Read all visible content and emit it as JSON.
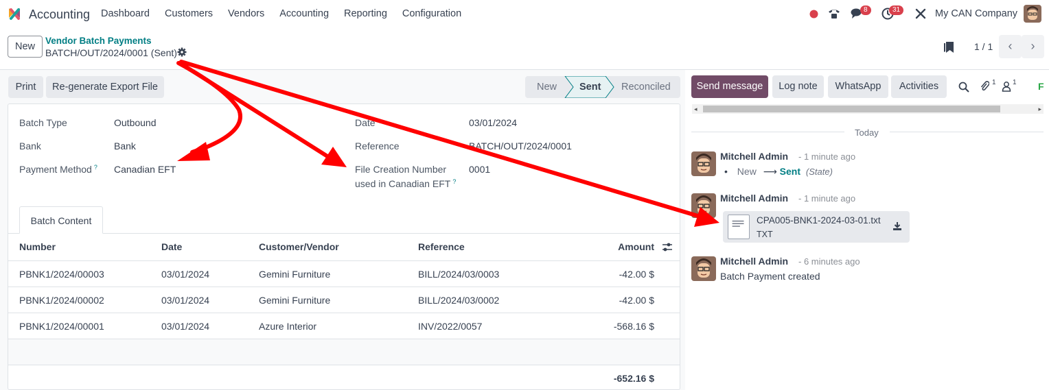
{
  "topnav": {
    "app_name": "Accounting",
    "menu": [
      "Dashboard",
      "Customers",
      "Vendors",
      "Accounting",
      "Reporting",
      "Configuration"
    ],
    "messages_badge": "8",
    "activities_badge": "31",
    "company": "My CAN Company"
  },
  "control": {
    "new_label": "New",
    "breadcrumb_parent": "Vendor Batch Payments",
    "breadcrumb_current": "BATCH/OUT/2024/0001 (Sent)",
    "pager": "1 / 1"
  },
  "actions": {
    "print": "Print",
    "regenerate": "Re-generate Export File"
  },
  "status": {
    "stages": [
      "New",
      "Sent",
      "Reconciled"
    ],
    "current": "Sent"
  },
  "form": {
    "batch_type_label": "Batch Type",
    "batch_type": "Outbound",
    "bank_label": "Bank",
    "bank": "Bank",
    "payment_method_label": "Payment Method",
    "payment_method": "Canadian EFT",
    "date_label": "Date",
    "date": "03/01/2024",
    "reference_label": "Reference",
    "reference": "BATCH/OUT/2024/0001",
    "file_creation_label_1": "File Creation Number",
    "file_creation_label_2": "used in Canadian EFT",
    "file_creation": "0001",
    "help_mark": "?"
  },
  "tab": {
    "label": "Batch Content"
  },
  "table": {
    "headers": [
      "Number",
      "Date",
      "Customer/Vendor",
      "Reference",
      "Amount"
    ],
    "rows": [
      {
        "number": "PBNK1/2024/00003",
        "date": "03/01/2024",
        "partner": "Gemini Furniture",
        "reference": "BILL/2024/03/0003",
        "amount": "-42.00 $"
      },
      {
        "number": "PBNK1/2024/00002",
        "date": "03/01/2024",
        "partner": "Gemini Furniture",
        "reference": "BILL/2024/03/0002",
        "amount": "-42.00 $"
      },
      {
        "number": "PBNK1/2024/00001",
        "date": "03/01/2024",
        "partner": "Azure Interior",
        "reference": "INV/2022/0057",
        "amount": "-568.16 $"
      }
    ],
    "total": "-652.16 $"
  },
  "chatter": {
    "send_message": "Send message",
    "log_note": "Log note",
    "whatsapp": "WhatsApp",
    "activities": "Activities",
    "attachments_count": "1",
    "followers_count": "1",
    "follow_initial": "F",
    "today": "Today",
    "messages": [
      {
        "author": "Mitchell Admin",
        "time": "- 1 minute ago",
        "old_value": "New",
        "new_value": "Sent",
        "field": "(State)"
      },
      {
        "author": "Mitchell Admin",
        "time": "- 1 minute ago",
        "attachment_name": "CPA005-BNK1-2024-03-01.txt",
        "attachment_ext": "TXT"
      },
      {
        "author": "Mitchell Admin",
        "time": "- 6 minutes ago",
        "body": "Batch Payment created"
      }
    ]
  },
  "colors": {
    "accent": "#714b67",
    "link": "#017e84",
    "annotation_arrow": "#ff0000"
  }
}
